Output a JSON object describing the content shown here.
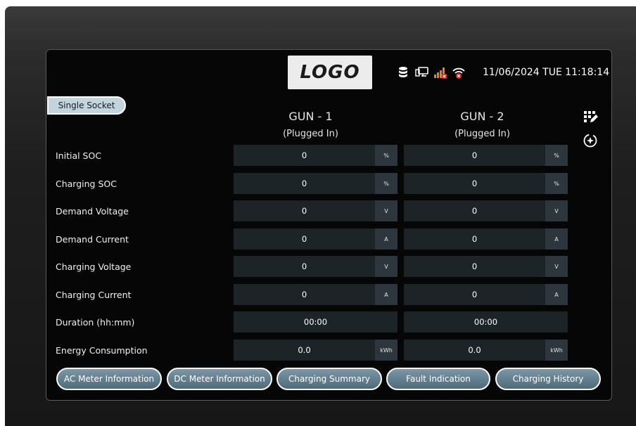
{
  "header": {
    "logo_text": "LOGO",
    "datetime": "11/06/2024 TUE 11:18:14",
    "status_icons": [
      "database-icon",
      "network-pc-icon",
      "signal-bars-disconnected-icon",
      "wifi-disconnected-icon"
    ]
  },
  "mode_label": "Single Socket",
  "guns": [
    {
      "title": "GUN - 1",
      "status": "(Plugged In)"
    },
    {
      "title": "GUN - 2",
      "status": "(Plugged In)"
    }
  ],
  "rows": [
    {
      "label": "Initial SOC",
      "gun1": "0",
      "gun2": "0",
      "unit": "%"
    },
    {
      "label": "Charging SOC",
      "gun1": "0",
      "gun2": "0",
      "unit": "%"
    },
    {
      "label": "Demand Voltage",
      "gun1": "0",
      "gun2": "0",
      "unit": "V"
    },
    {
      "label": "Demand Current",
      "gun1": "0",
      "gun2": "0",
      "unit": "A"
    },
    {
      "label": "Charging Voltage",
      "gun1": "0",
      "gun2": "0",
      "unit": "V"
    },
    {
      "label": "Charging Current",
      "gun1": "0",
      "gun2": "0",
      "unit": "A"
    },
    {
      "label": "Duration (hh:mm)",
      "gun1": "00:00",
      "gun2": "00:00",
      "unit": ""
    },
    {
      "label": "Energy Consumption",
      "gun1": "0.0",
      "gun2": "0.0",
      "unit": "kWh"
    }
  ],
  "side_icons": [
    "keypad-edit-icon",
    "settings-sparkle-icon"
  ],
  "bottom_buttons": [
    "AC Meter Information",
    "DC Meter Information",
    "Charging Summary",
    "Fault Indication",
    "Charging History"
  ],
  "colors": {
    "screen_bg": "#060606",
    "cell_bg": "#1d2428",
    "unit_bg": "#2d363c",
    "button": "#5f7a8a",
    "alert_red": "#e0262a"
  }
}
